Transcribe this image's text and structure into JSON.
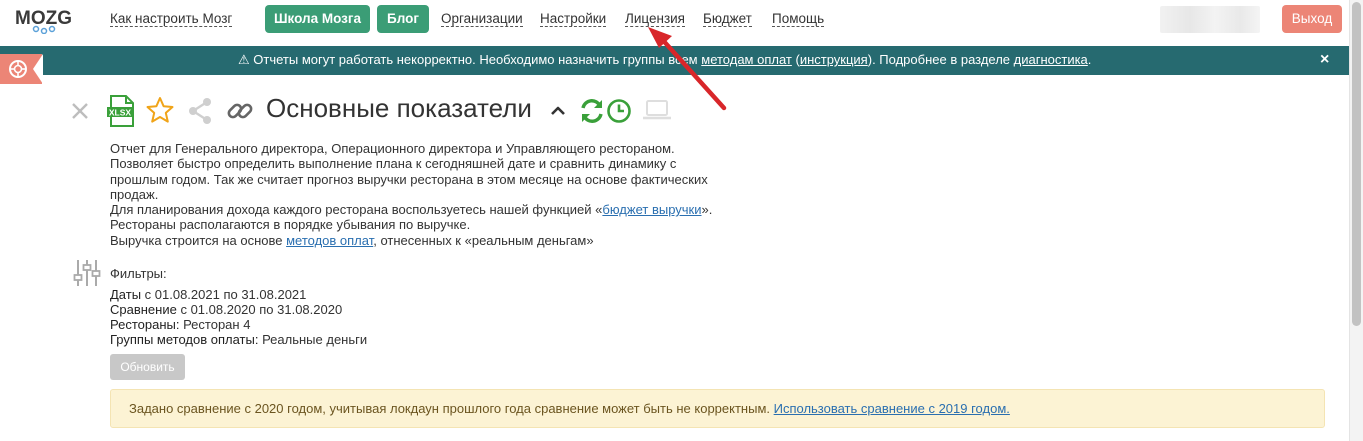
{
  "nav": {
    "logo": "MOZG",
    "links": [
      "Как настроить Мозг",
      "Организации",
      "Настройки",
      "Лицензия",
      "Бюджет",
      "Помощь"
    ],
    "school_btn": "Школа Мозга",
    "blog_btn": "Блог",
    "logout": "Выход"
  },
  "alert": {
    "icon": "warning-icon",
    "text_1": "Отчеты могут работать некорректно. Необходимо назначить группы всем ",
    "link_1": "методам оплат",
    "text_2": " (",
    "link_2": "инструкция",
    "text_3": "). Подробнее в разделе ",
    "link_3": "диагностика",
    "text_4": ".",
    "close": "×"
  },
  "toolbar": {
    "icons": [
      "close-icon",
      "xlsx-export-icon",
      "star-icon",
      "share-icon",
      "link-icon",
      "collapse-icon",
      "refresh-icon",
      "clock-icon",
      "laptop-icon"
    ],
    "xlsx_label": "XLSX"
  },
  "report": {
    "title": "Основные показатели",
    "desc_lines": [
      "Отчет для Генерального директора, Операционного директора и Управляющего рестораном.",
      "Позволяет быстро определить выполнение плана к сегодняшней дате и сравнить динамику с",
      "прошлым годом. Так же считает прогноз выручки ресторана в этом месяце на основе фактических",
      "продаж."
    ],
    "budget_pre": "Для планирования дохода каждого ресторана воспользуетесь нашей функцией «",
    "budget_link": "бюджет выручки",
    "budget_post": "».",
    "sort_line": "Рестораны располагаются в порядке убывания по выручке.",
    "revenue_pre": "Выручка строится на основе ",
    "revenue_link": "методов оплат",
    "revenue_post": ", отнесенных к «реальным деньгам»"
  },
  "filters": {
    "label": "Фильтры:",
    "dates_label": "Даты",
    "dates_value": " с 01.08.2021 по 31.08.2021",
    "compare_label": "Сравнение",
    "compare_value": " с 01.08.2020 по 31.08.2020",
    "restaurants_label": "Рестораны:",
    "restaurants_value": " Ресторан 4",
    "groups_label": "Группы методов оплаты:",
    "groups_value": " Реальные деньги",
    "refresh_btn": "Обновить"
  },
  "warning": {
    "text": "Задано сравнение с 2020 годом, учитывая локдаун прошлого года сравнение может быть не корректным. ",
    "link": "Использовать сравнение с 2019 годом."
  },
  "colors": {
    "accent_green": "#3b9d76",
    "banner_teal": "#266a70",
    "logout_red": "#ec8576",
    "warning_bg": "#fcf3d4",
    "link_blue": "#2a6fb0"
  }
}
